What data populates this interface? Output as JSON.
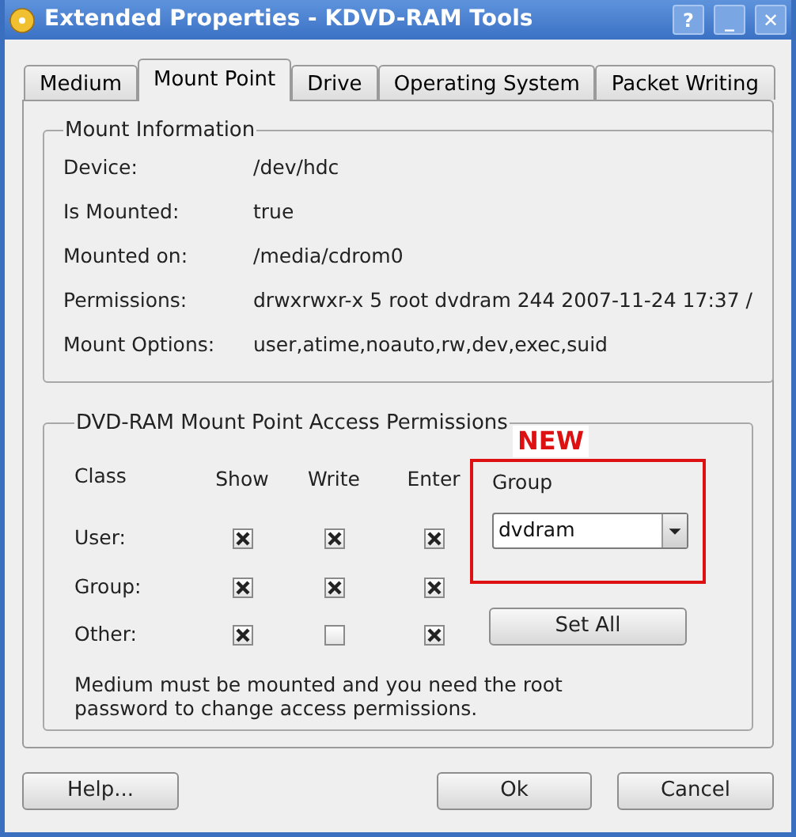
{
  "window": {
    "title": "Extended Properties - KDVD-RAM Tools",
    "controls": [
      "?",
      "_",
      "✕"
    ]
  },
  "tabs": [
    {
      "label": "Medium",
      "selected": false
    },
    {
      "label": "Mount Point",
      "selected": true
    },
    {
      "label": "Drive",
      "selected": false
    },
    {
      "label": "Operating System",
      "selected": false
    },
    {
      "label": "Packet Writing",
      "selected": false
    }
  ],
  "mount_information": {
    "title": "Mount Information",
    "rows": [
      {
        "label": "Device:",
        "value": "/dev/hdc"
      },
      {
        "label": "Is Mounted:",
        "value": "true"
      },
      {
        "label": "Mounted on:",
        "value": "/media/cdrom0"
      },
      {
        "label": "Permissions:",
        "value": "drwxrwxr-x 5 root dvdram 244 2007-11-24 17:37 /"
      },
      {
        "label": "Mount Options:",
        "value": "user,atime,noauto,rw,dev,exec,suid"
      }
    ]
  },
  "access_permissions": {
    "title": "DVD-RAM Mount Point Access Permissions",
    "columns": [
      "Class",
      "Show",
      "Write",
      "Enter",
      "Group"
    ],
    "rows": [
      {
        "class": "User:",
        "show": true,
        "write": true,
        "enter": true
      },
      {
        "class": "Group:",
        "show": true,
        "write": true,
        "enter": true
      },
      {
        "class": "Other:",
        "show": true,
        "write": false,
        "enter": true
      }
    ],
    "group_value": "dvdram",
    "annotation": "NEW",
    "set_all_button": "Set All",
    "note": "Medium must be mounted and you need the root password to change access permissions."
  },
  "buttons": [
    "Help...",
    "Ok",
    "Cancel"
  ]
}
